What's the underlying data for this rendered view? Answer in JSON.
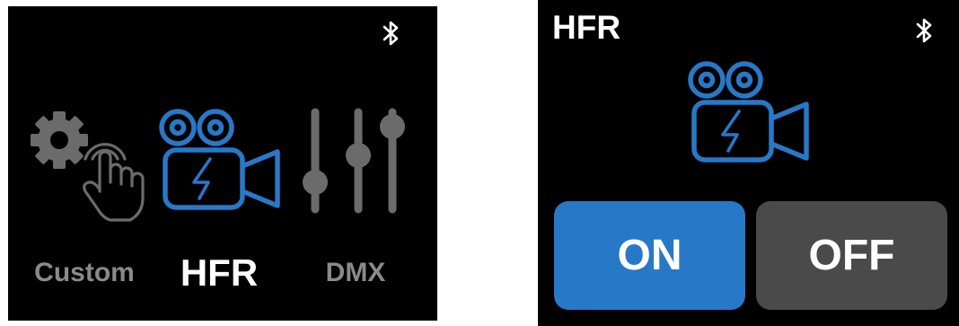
{
  "menu_screen": {
    "items": [
      {
        "label": "Custom",
        "icon": "gear-hand-icon",
        "selected": false
      },
      {
        "label": "HFR",
        "icon": "camera-flash-icon",
        "selected": true
      },
      {
        "label": "DMX",
        "icon": "sliders-icon",
        "selected": false
      }
    ],
    "status_icon": "bluetooth-icon"
  },
  "detail_screen": {
    "title": "HFR",
    "status_icon": "bluetooth-icon",
    "icon": "camera-flash-icon",
    "on_label": "ON",
    "off_label": "OFF",
    "selected": "ON"
  },
  "colors": {
    "background": "#000000",
    "accent": "#2878c8",
    "inactive_gray": "#6b6b6b",
    "off_button": "#4a4a4a",
    "text_white": "#ffffff",
    "text_gray": "#8a8a8a"
  }
}
